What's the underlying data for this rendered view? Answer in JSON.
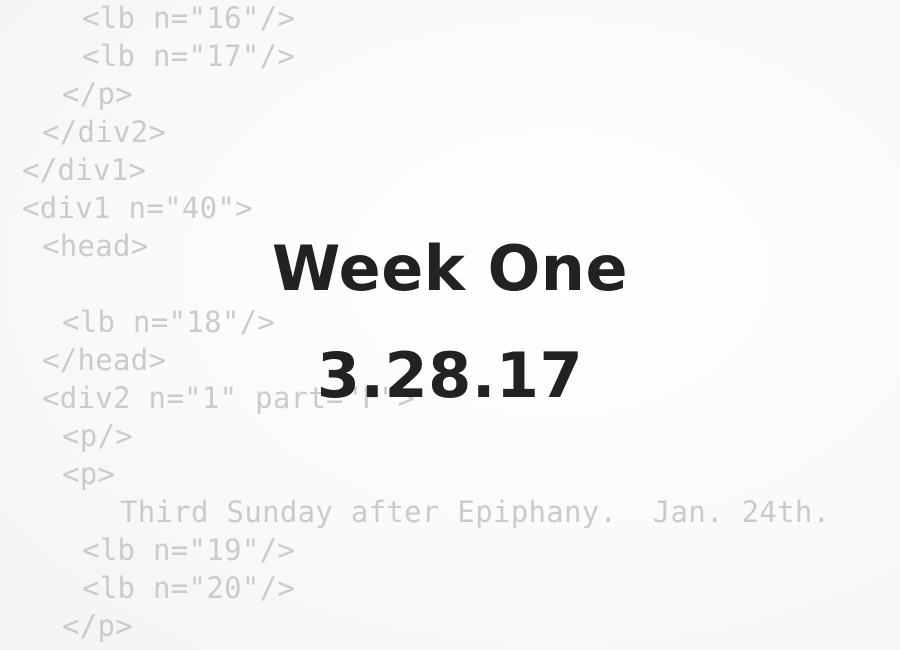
{
  "background_code": [
    "<lb n=\"16\"/>",
    "<lb n=\"17\"/>",
    "</p>",
    "</div2>",
    "</div1>",
    "<div1 n=\"40\">",
    "<head>",
    "<lb n=\"18\"/>",
    "</head>",
    "<div2 n=\"1\" part=\"F\">",
    "<p/>",
    "<p>",
    "Third Sunday after Epiphany.  Jan. 24th.",
    "<lb n=\"19\"/>",
    "<lb n=\"20\"/>",
    "</p>"
  ],
  "title": {
    "heading": "Week One",
    "date": "3.28.17"
  },
  "colors": {
    "code_text": "#cbcbcb",
    "title_text": "#222222",
    "background": "#fbfbf9"
  }
}
